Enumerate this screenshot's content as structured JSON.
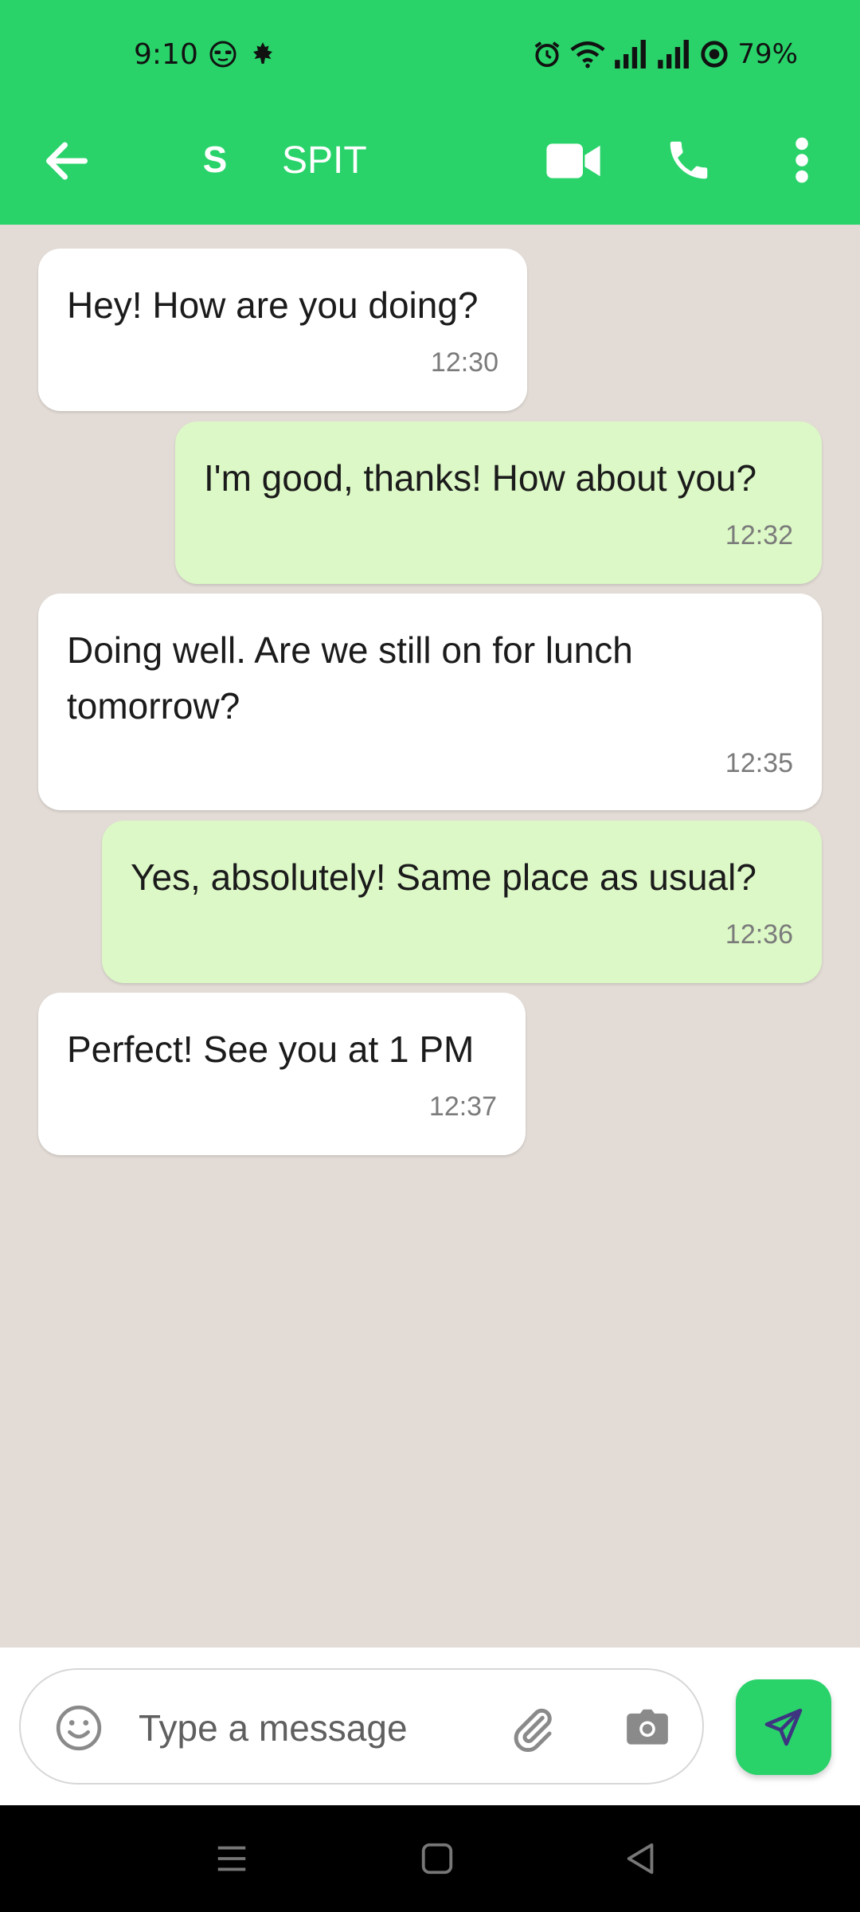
{
  "status_bar": {
    "time": "9:10",
    "battery": "79%",
    "icons": [
      "face-glasses-icon",
      "maple-leaf-icon",
      "alarm-icon",
      "wifi-icon",
      "signal-icon",
      "signal-icon",
      "battery-ring-icon"
    ]
  },
  "header": {
    "avatar_initial": "S",
    "title": "SPIT",
    "icons": [
      "back-arrow-icon",
      "video-camera-icon",
      "phone-icon",
      "more-vert-icon"
    ]
  },
  "messages": [
    {
      "direction": "incoming",
      "text": "Hey! How are you doing?",
      "time": "12:30"
    },
    {
      "direction": "outgoing",
      "text": "I'm good, thanks! How about you?",
      "time": "12:32"
    },
    {
      "direction": "incoming",
      "text": "Doing well. Are we still on for lunch tomorrow?",
      "time": "12:35"
    },
    {
      "direction": "outgoing",
      "text": "Yes, absolutely! Same place as usual?",
      "time": "12:36"
    },
    {
      "direction": "incoming",
      "text": "Perfect! See you at 1 PM",
      "time": "12:37"
    }
  ],
  "composer": {
    "placeholder": "Type a message",
    "icons": [
      "emoji-icon",
      "paperclip-icon",
      "camera-icon",
      "send-icon"
    ]
  },
  "colors": {
    "accent": "#29d36a",
    "chat_background": "#e3dcd6",
    "incoming_bubble": "#ffffff",
    "outgoing_bubble": "#dcf8c6",
    "send_icon": "#3d3580"
  }
}
